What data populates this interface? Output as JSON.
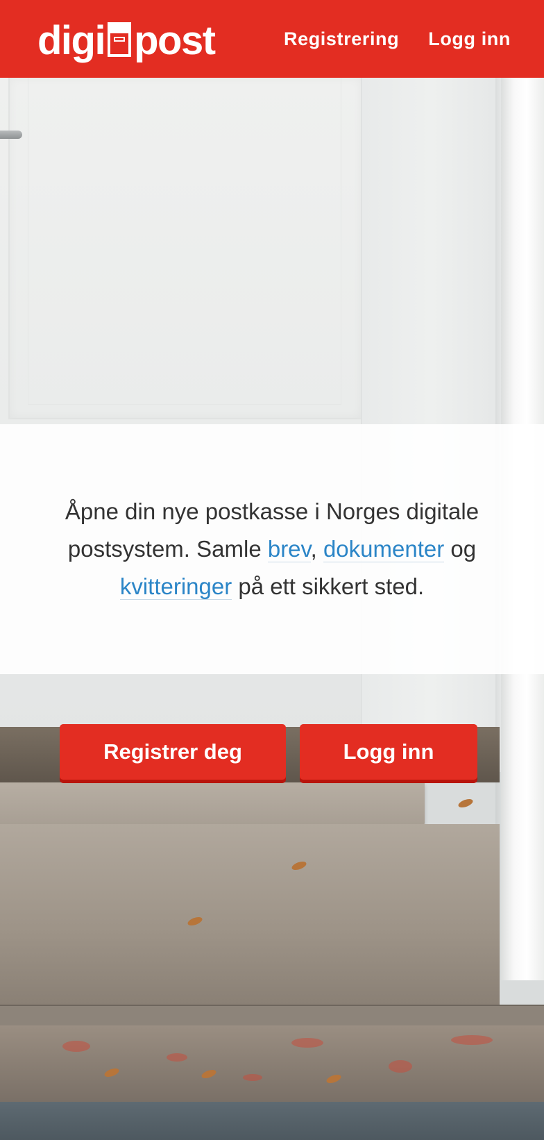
{
  "header": {
    "logo_left": "digi",
    "logo_right": "post",
    "nav": {
      "register": "Registrering",
      "login": "Logg inn"
    }
  },
  "intro": {
    "text_1": "Åpne din nye postkasse i Norges digitale postsystem. Samle ",
    "link_letters": "brev",
    "text_2": ", ",
    "link_documents": "dokumenter",
    "text_3": " og ",
    "link_receipts": "kvitteringer",
    "text_4": " på ett sikkert sted."
  },
  "buttons": {
    "register": "Registrer deg",
    "login": "Logg inn"
  },
  "colors": {
    "brand_red": "#e32d22",
    "link_blue": "#2b85c7"
  }
}
